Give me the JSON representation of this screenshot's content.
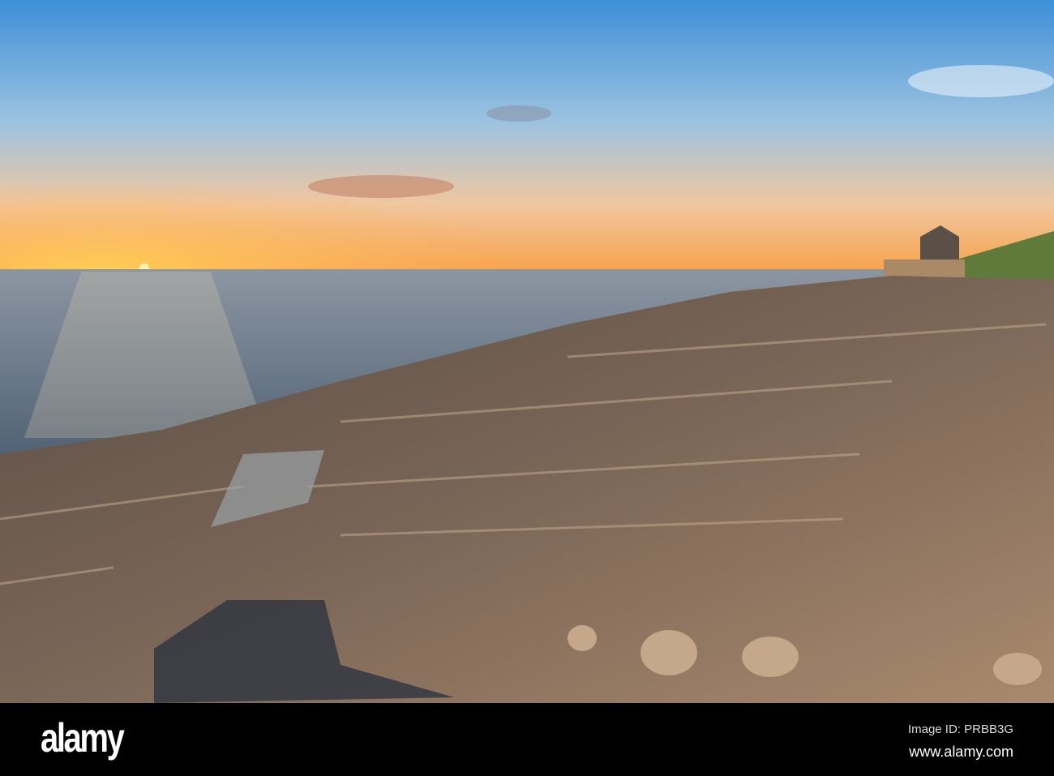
{
  "photo": {
    "description_icon": "coastal-sunset-photo"
  },
  "footer": {
    "logo": "alamy",
    "image_id": "Image ID: PRBB3G",
    "url": "www.alamy.com"
  },
  "colors": {
    "sky_top": "#3f8fd6",
    "sun": "#ffd25a",
    "sea": "#6f8194",
    "rock": "#6b5a4c",
    "footer": "#000000"
  }
}
